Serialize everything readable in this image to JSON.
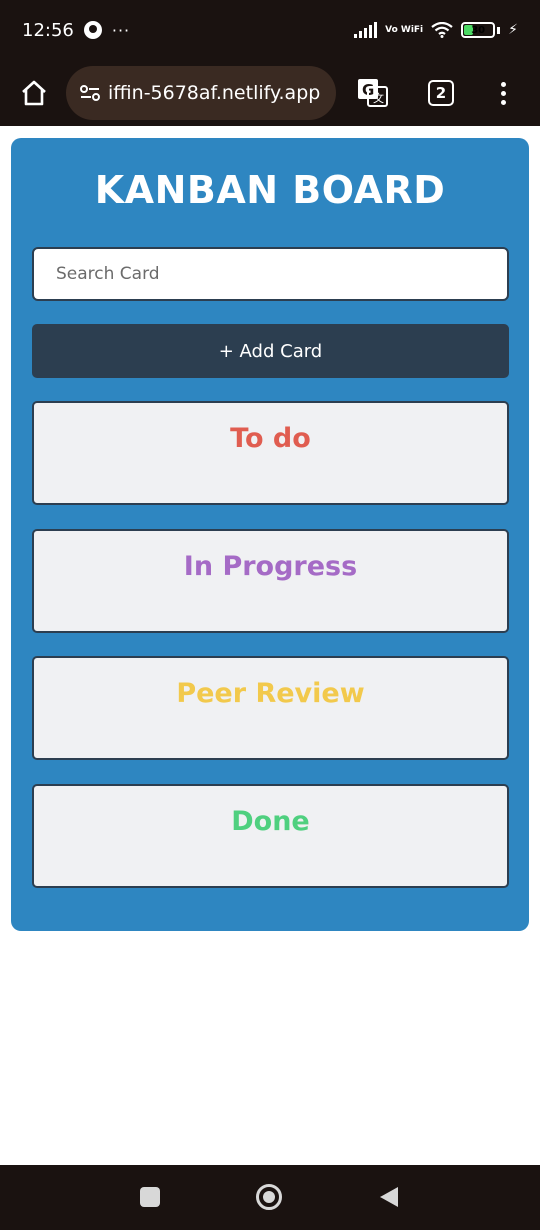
{
  "status_bar": {
    "time": "12:56",
    "overflow": "···",
    "network_label": "Vo WiFi",
    "battery_level": "30",
    "battery_fraction": 0.3
  },
  "browser": {
    "url": "iffin-5678af.netlify.app",
    "tab_count": "2"
  },
  "page": {
    "title": "KANBAN BOARD",
    "search_placeholder": "Search Card",
    "add_button_label": "+ Add Card",
    "columns": [
      {
        "title": "To do",
        "color": "#e05d50"
      },
      {
        "title": "In Progress",
        "color": "#a56bc6"
      },
      {
        "title": "Peer Review",
        "color": "#f2c94c"
      },
      {
        "title": "Done",
        "color": "#4fd07f"
      }
    ]
  },
  "colors": {
    "board_bg": "#2e86c1",
    "button_bg": "#2c3e50",
    "column_bg": "#f0f1f3"
  }
}
